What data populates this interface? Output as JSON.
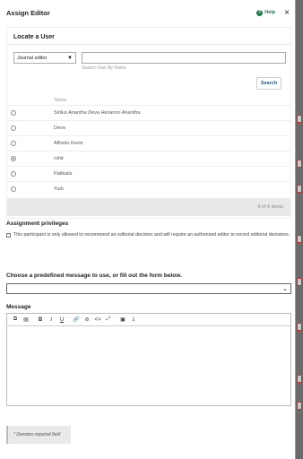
{
  "modal": {
    "title": "Assign Editor",
    "help_label": "Help",
    "close_glyph": "×"
  },
  "locate": {
    "title": "Locate a User",
    "role_select": {
      "selected": "Journal editor"
    },
    "search": {
      "placeholder": "Search User By Name",
      "button_label": "Search"
    },
    "column_header": "Name",
    "users": [
      {
        "name": "Sirilus Anantha Deva Hexanno Anantha",
        "selected": false
      },
      {
        "name": "Deva",
        "selected": false
      },
      {
        "name": "Alfredo Kevin",
        "selected": false
      },
      {
        "name": "rohit",
        "selected": true
      },
      {
        "name": "Patikalis",
        "selected": false
      },
      {
        "name": "Yudi",
        "selected": false
      }
    ],
    "pager_text": "6 of 6 items"
  },
  "privileges": {
    "title": "Assignment privileges",
    "checkbox_text": "This participant is only allowed to recommend an editorial decision and will require an authorised editor to record editorial decisions."
  },
  "predefined": {
    "title": "Choose a predefined message to use, or fill out the form below.",
    "selected": ""
  },
  "message": {
    "title": "Message",
    "toolbar_icons": [
      "copy-icon",
      "paste-icon",
      "bold-icon",
      "italic-icon",
      "underline-icon",
      "link-icon",
      "unlink-icon",
      "code-icon",
      "fullscreen-icon",
      "image-icon",
      "upload-icon"
    ]
  },
  "footer": {
    "required_note": "* Denotes required field"
  },
  "colors": {
    "help_green": "#1a7a4a",
    "link_blue": "#1a5b88"
  }
}
